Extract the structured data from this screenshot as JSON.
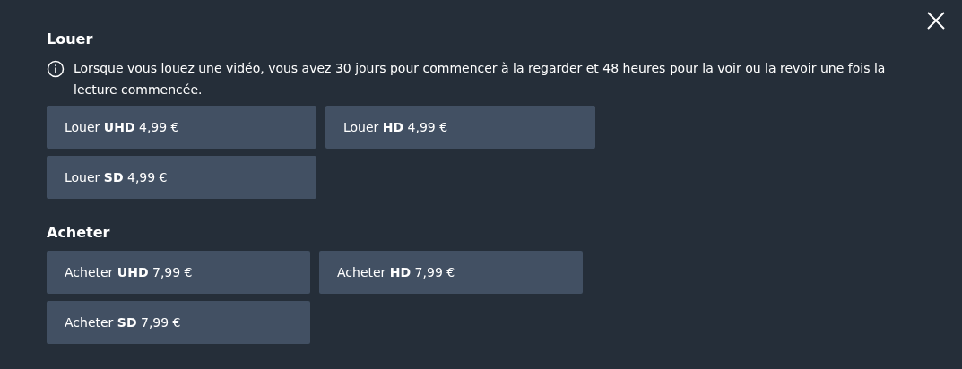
{
  "sections": [
    {
      "title": "Louer",
      "info": "Lorsque vous louez une vidéo, vous avez 30 jours pour commencer à la regarder et 48 heures pour la voir ou la revoir une fois la lecture commencée.",
      "options": [
        {
          "label": "Louer **UHD** 4,99 €"
        },
        {
          "label": "Louer **HD** 4,99 €"
        },
        {
          "label": "Louer **SD** 4,99 €"
        }
      ]
    },
    {
      "title": "Acheter",
      "options": [
        {
          "label": "Acheter **UHD** 7,99 €"
        },
        {
          "label": "Acheter **HD** 7,99 €"
        },
        {
          "label": "Acheter **SD** 7,99 €"
        }
      ]
    }
  ]
}
